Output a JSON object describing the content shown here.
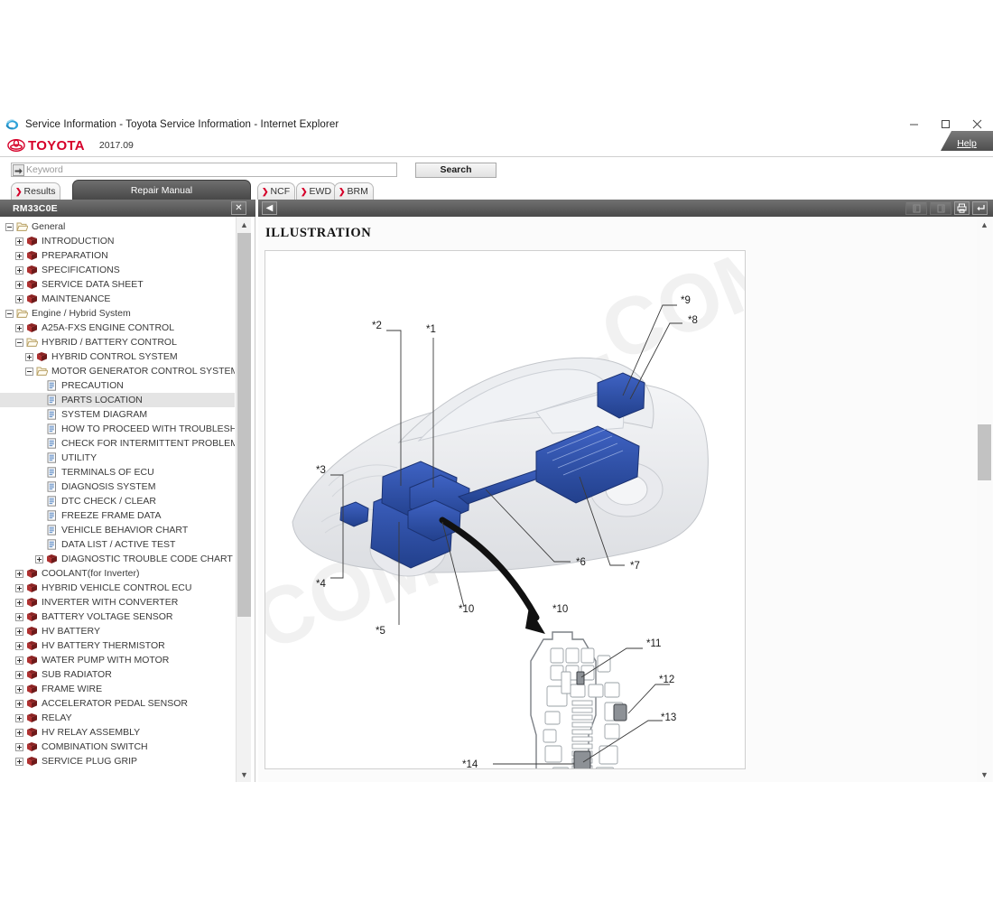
{
  "window": {
    "title": "Service Information - Toyota Service Information - Internet Explorer",
    "icon": "internet-explorer-icon",
    "minimize_label": "─",
    "maximize_label": "□",
    "close_label": "✕"
  },
  "brand": {
    "name": "TOYOTA",
    "version": "2017.09",
    "help_label": "Help"
  },
  "search": {
    "placeholder": "Keyword",
    "value": "",
    "button_label": "Search",
    "input_icon": "arrow-right-icon"
  },
  "tabs": [
    {
      "label": "Results",
      "active": false,
      "arrow": "❯"
    },
    {
      "label": "Repair Manual",
      "active": true,
      "arrow": ""
    },
    {
      "label": "NCF",
      "active": false,
      "arrow": "❯"
    },
    {
      "label": "EWD",
      "active": false,
      "arrow": "❯"
    },
    {
      "label": "BRM",
      "active": false,
      "arrow": "❯"
    }
  ],
  "manual_bar": {
    "code": "RM33C0E",
    "close_label": "✕",
    "collapse_label": "◀"
  },
  "doc_toolbar": {
    "prev_label": "◧",
    "next_label": "◨",
    "print_label": "print-icon",
    "return_label": "return-icon"
  },
  "tree": [
    {
      "label": "General",
      "indent": 0,
      "expander": "minus",
      "icon": "folder-open-icon"
    },
    {
      "label": "INTRODUCTION",
      "indent": 1,
      "expander": "plus",
      "icon": "book-icon"
    },
    {
      "label": "PREPARATION",
      "indent": 1,
      "expander": "plus",
      "icon": "book-icon"
    },
    {
      "label": "SPECIFICATIONS",
      "indent": 1,
      "expander": "plus",
      "icon": "book-icon"
    },
    {
      "label": "SERVICE DATA SHEET",
      "indent": 1,
      "expander": "plus",
      "icon": "book-icon"
    },
    {
      "label": "MAINTENANCE",
      "indent": 1,
      "expander": "plus",
      "icon": "book-icon"
    },
    {
      "label": "Engine / Hybrid System",
      "indent": 0,
      "expander": "minus",
      "icon": "folder-open-icon"
    },
    {
      "label": "A25A-FXS ENGINE CONTROL",
      "indent": 1,
      "expander": "plus",
      "icon": "book-icon"
    },
    {
      "label": "HYBRID / BATTERY CONTROL",
      "indent": 1,
      "expander": "minus",
      "icon": "folder-open-icon"
    },
    {
      "label": "HYBRID CONTROL SYSTEM",
      "indent": 2,
      "expander": "plus",
      "icon": "book-icon"
    },
    {
      "label": "MOTOR GENERATOR CONTROL SYSTEM",
      "indent": 2,
      "expander": "minus",
      "icon": "folder-open-icon"
    },
    {
      "label": "PRECAUTION",
      "indent": 3,
      "expander": "none",
      "icon": "page-icon"
    },
    {
      "label": "PARTS LOCATION",
      "indent": 3,
      "expander": "none",
      "icon": "page-icon",
      "selected": true
    },
    {
      "label": "SYSTEM DIAGRAM",
      "indent": 3,
      "expander": "none",
      "icon": "page-icon"
    },
    {
      "label": "HOW TO PROCEED WITH TROUBLESHOOTING",
      "indent": 3,
      "expander": "none",
      "icon": "page-icon"
    },
    {
      "label": "CHECK FOR INTERMITTENT PROBLEMS",
      "indent": 3,
      "expander": "none",
      "icon": "page-icon"
    },
    {
      "label": "UTILITY",
      "indent": 3,
      "expander": "none",
      "icon": "page-icon"
    },
    {
      "label": "TERMINALS OF ECU",
      "indent": 3,
      "expander": "none",
      "icon": "page-icon"
    },
    {
      "label": "DIAGNOSIS SYSTEM",
      "indent": 3,
      "expander": "none",
      "icon": "page-icon"
    },
    {
      "label": "DTC CHECK / CLEAR",
      "indent": 3,
      "expander": "none",
      "icon": "page-icon"
    },
    {
      "label": "FREEZE FRAME DATA",
      "indent": 3,
      "expander": "none",
      "icon": "page-icon"
    },
    {
      "label": "VEHICLE BEHAVIOR CHART",
      "indent": 3,
      "expander": "none",
      "icon": "page-icon"
    },
    {
      "label": "DATA LIST / ACTIVE TEST",
      "indent": 3,
      "expander": "none",
      "icon": "page-icon"
    },
    {
      "label": "DIAGNOSTIC TROUBLE CODE CHART",
      "indent": 3,
      "expander": "plus",
      "icon": "book-icon"
    },
    {
      "label": "COOLANT(for Inverter)",
      "indent": 1,
      "expander": "plus",
      "icon": "book-icon"
    },
    {
      "label": "HYBRID VEHICLE CONTROL ECU",
      "indent": 1,
      "expander": "plus",
      "icon": "book-icon"
    },
    {
      "label": "INVERTER WITH CONVERTER",
      "indent": 1,
      "expander": "plus",
      "icon": "book-icon"
    },
    {
      "label": "BATTERY VOLTAGE SENSOR",
      "indent": 1,
      "expander": "plus",
      "icon": "book-icon"
    },
    {
      "label": "HV BATTERY",
      "indent": 1,
      "expander": "plus",
      "icon": "book-icon"
    },
    {
      "label": "HV BATTERY THERMISTOR",
      "indent": 1,
      "expander": "plus",
      "icon": "book-icon"
    },
    {
      "label": "WATER PUMP WITH MOTOR",
      "indent": 1,
      "expander": "plus",
      "icon": "book-icon"
    },
    {
      "label": "SUB RADIATOR",
      "indent": 1,
      "expander": "plus",
      "icon": "book-icon"
    },
    {
      "label": "FRAME WIRE",
      "indent": 1,
      "expander": "plus",
      "icon": "book-icon"
    },
    {
      "label": "ACCELERATOR PEDAL SENSOR",
      "indent": 1,
      "expander": "plus",
      "icon": "book-icon"
    },
    {
      "label": "RELAY",
      "indent": 1,
      "expander": "plus",
      "icon": "book-icon"
    },
    {
      "label": "HV RELAY ASSEMBLY",
      "indent": 1,
      "expander": "plus",
      "icon": "book-icon"
    },
    {
      "label": "COMBINATION SWITCH",
      "indent": 1,
      "expander": "plus",
      "icon": "book-icon"
    },
    {
      "label": "SERVICE PLUG GRIP",
      "indent": 1,
      "expander": "plus",
      "icon": "book-icon"
    }
  ],
  "document": {
    "heading": "ILLUSTRATION",
    "watermark_text": ".COM",
    "callouts_vehicle": [
      "*1",
      "*2",
      "*3",
      "*4",
      "*5",
      "*6",
      "*7",
      "*8",
      "*9",
      "*10"
    ],
    "callouts_fusebox": [
      "*10",
      "*11",
      "*12",
      "*13",
      "*14"
    ]
  },
  "colors": {
    "brand_red": "#d6002a",
    "component_blue": "#2d50a8",
    "bar_dark": "#5a5a5a",
    "selection": "#e4e4e4"
  }
}
